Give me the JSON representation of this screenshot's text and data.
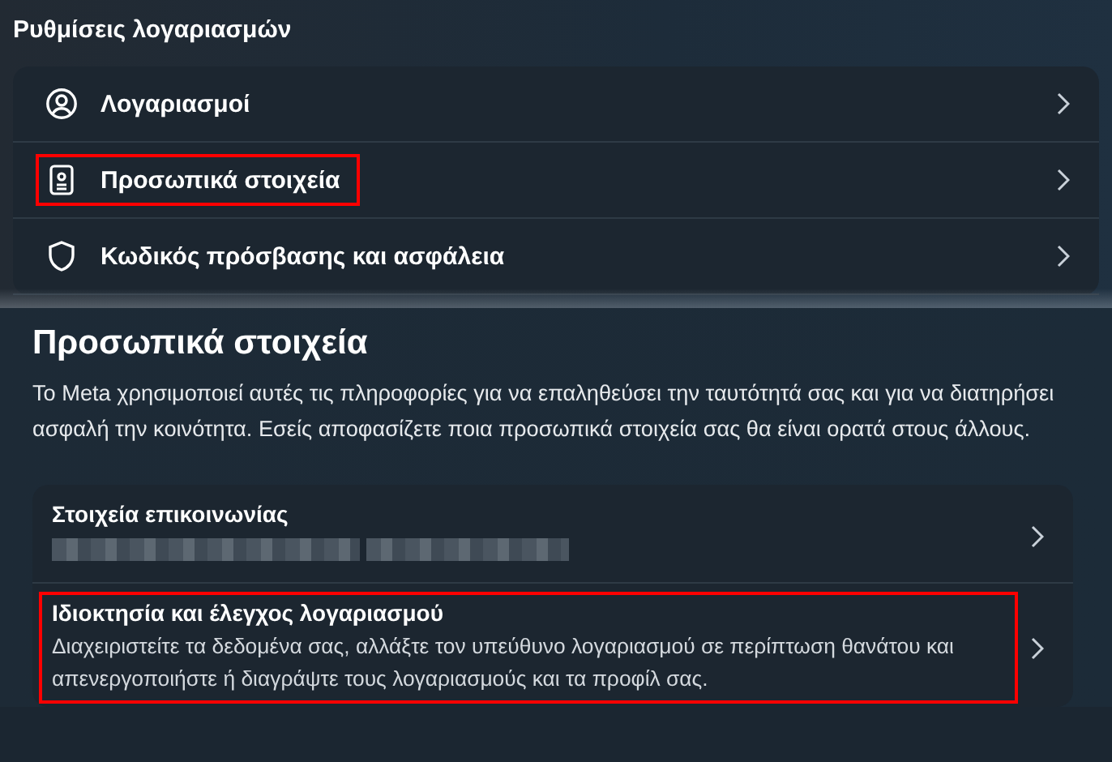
{
  "settings": {
    "title": "Ρυθμίσεις λογαριασμών",
    "items": [
      {
        "kind": "account",
        "label": "Λογαριασμοί",
        "highlighted": false
      },
      {
        "kind": "personal",
        "label": "Προσωπικά στοιχεία",
        "highlighted": true
      },
      {
        "kind": "security",
        "label": "Κωδικός πρόσβασης και ασφάλεια",
        "highlighted": false
      }
    ]
  },
  "personal": {
    "title": "Προσωπικά στοιχεία",
    "description": "Το Meta χρησιμοποιεί αυτές τις πληροφορίες για να επαληθεύσει την ταυτότητά σας και για να διατηρήσει ασφαλή την κοινότητα. Εσείς αποφασίζετε ποια προσωπικά στοιχεία σας θα είναι ορατά στους άλλους.",
    "items": [
      {
        "label": "Στοιχεία επικοινωνίας",
        "redacted": true,
        "highlighted": false
      },
      {
        "label": "Ιδιοκτησία και έλεγχος λογαριασμού",
        "description": "Διαχειριστείτε τα δεδομένα σας, αλλάξτε τον υπεύθυνο λογαριασμού σε περίπτωση θανάτου και απενεργοποιήστε ή διαγράψτε τους λογαριασμούς και τα προφίλ σας.",
        "redacted": false,
        "highlighted": true
      }
    ]
  }
}
